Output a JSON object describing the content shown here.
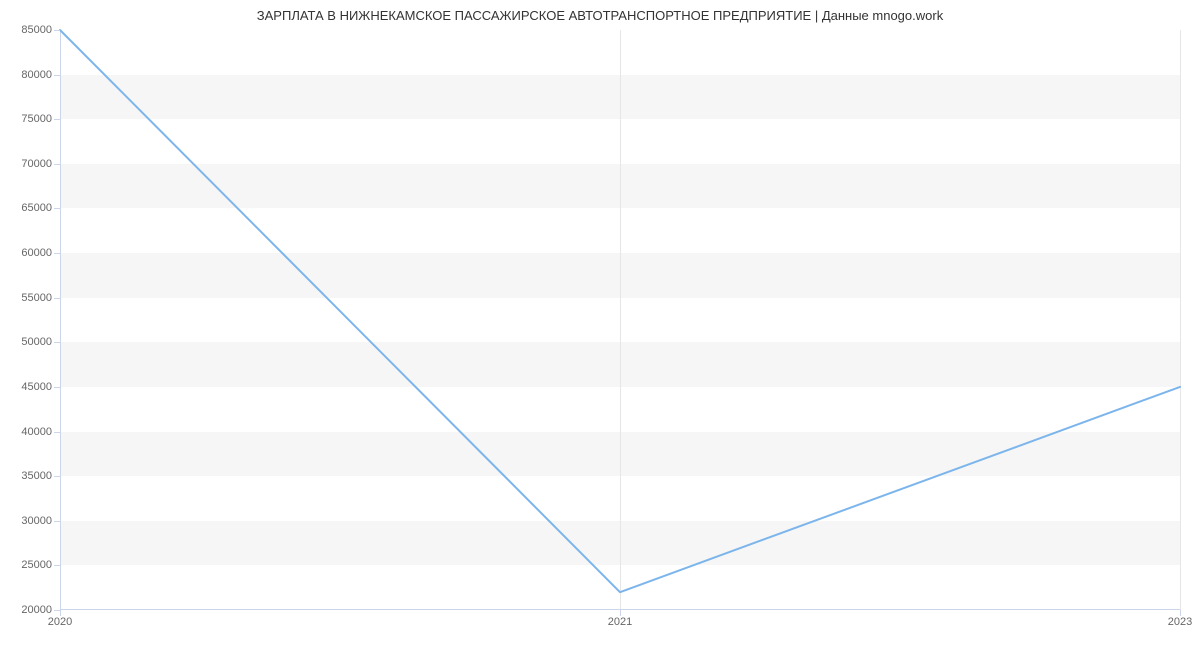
{
  "chart_data": {
    "type": "line",
    "title": "ЗАРПЛАТА В  НИЖНЕКАМСКОЕ ПАССАЖИРСКОЕ АВТОТРАНСПОРТНОЕ ПРЕДПРИЯТИЕ | Данные mnogo.work",
    "x": [
      2020,
      2021,
      2023
    ],
    "values": [
      85000,
      22000,
      45000
    ],
    "xlabel": "",
    "ylabel": "",
    "ylim": [
      20000,
      85000
    ],
    "y_ticks": [
      20000,
      25000,
      30000,
      35000,
      40000,
      45000,
      50000,
      55000,
      60000,
      65000,
      70000,
      75000,
      80000,
      85000
    ],
    "x_ticks": [
      2020,
      2021,
      2023
    ],
    "line_color": "#7cb5ec"
  }
}
